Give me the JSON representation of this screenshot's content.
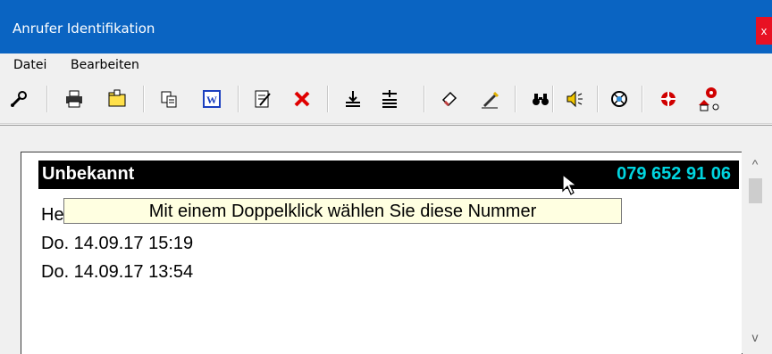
{
  "window": {
    "title": "Anrufer Identifikation",
    "close_glyph": "x"
  },
  "menu": {
    "items": [
      "Datei",
      "Bearbeiten"
    ]
  },
  "toolbar": {
    "icons": [
      "wrench-icon",
      "printer-icon",
      "folder-icon",
      "copy-icon",
      "word-icon",
      "edit-note-icon",
      "delete-icon",
      "import-icon",
      "import-all-icon",
      "eraser-icon",
      "pencil-icon",
      "binoculars-icon",
      "speaker-icon",
      "network-icon",
      "help-icon",
      "help-home-icon"
    ]
  },
  "caller": {
    "name": "Unbekannt",
    "number": "079 652 91 06",
    "line_prefix": "He",
    "entries": [
      "Do.  14.09.17  15:19",
      "Do.  14.09.17  13:54"
    ]
  },
  "tooltip": {
    "text": "Mit einem Doppelklick wählen Sie diese Nummer"
  },
  "scrollbar": {
    "up_glyph": "^",
    "down_glyph": "v"
  },
  "colors": {
    "titlebar": "#0a64c2",
    "phone_text": "#00d5e0",
    "namebar": "#000000",
    "tooltip_bg": "#ffffe1"
  }
}
